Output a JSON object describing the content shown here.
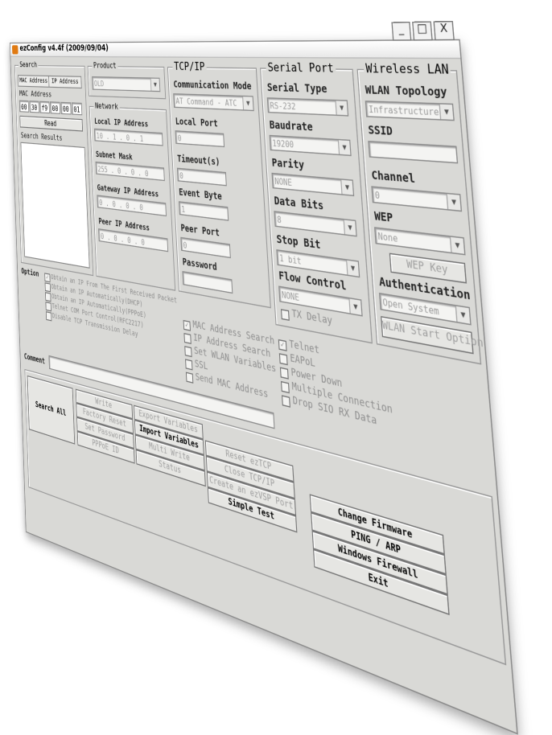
{
  "window": {
    "title": "ezConfig v4.4f (2009/09/04)",
    "controls": [
      "_",
      "□",
      "X"
    ]
  },
  "search": {
    "legend": "Search",
    "tabs": [
      "MAC Address",
      "IP Address"
    ],
    "mac_label": "MAC Address",
    "mac_octets": [
      "00",
      "30",
      "f9",
      "00",
      "00",
      "01"
    ],
    "read_button": "Read",
    "results_label": "Search Results"
  },
  "product": {
    "legend": "Product",
    "value": "OLD"
  },
  "network": {
    "legend": "Network",
    "local_ip_label": "Local IP Address",
    "local_ip": "10 . 1 . 0 . 1",
    "subnet_label": "Subnet Mask",
    "subnet": "255 . 0 . 0 . 0",
    "gateway_label": "Gateway IP Address",
    "gateway": "0 . 0 . 0 . 0",
    "peer_ip_label": "Peer IP Address",
    "peer_ip": "0 . 0 . 0 . 0"
  },
  "tcpip": {
    "legend": "TCP/IP",
    "comm_mode_label": "Communication Mode",
    "comm_mode": "AT Command - ATC",
    "local_port_label": "Local Port",
    "local_port": "0",
    "timeout_label": "Timeout(s)",
    "timeout": "0",
    "event_byte_label": "Event Byte",
    "event_byte": "1",
    "peer_port_label": "Peer Port",
    "peer_port": "0",
    "password_label": "Password",
    "password": ""
  },
  "serial": {
    "legend": "Serial Port",
    "type_label": "Serial Type",
    "type": "RS-232",
    "baud_label": "Baudrate",
    "baud": "19200",
    "parity_label": "Parity",
    "parity": "NONE",
    "databits_label": "Data Bits",
    "databits": "8",
    "stopbit_label": "Stop Bit",
    "stopbit": "1 bit",
    "flow_label": "Flow Control",
    "flow": "NONE",
    "tx_delay": "TX Delay"
  },
  "wlan": {
    "legend": "Wireless LAN",
    "topology_label": "WLAN Topology",
    "topology": "Infrastructure",
    "ssid_label": "SSID",
    "ssid": "",
    "channel_label": "Channel",
    "channel": "0",
    "wep_label": "WEP",
    "wep": "None",
    "wep_key_button": "WEP Key",
    "auth_label": "Authentication",
    "auth": "Open System",
    "start_button": "WLAN Start Option"
  },
  "option": {
    "label": "Option",
    "left": [
      "Obtain an IP From The First Received Packet",
      "Obtain an IP Automatically(DHCP)",
      "Obtain an IP Automatically(PPPoE)",
      "Telnet COM Port Control(RFC2217)",
      "Disable TCP Transmission Delay"
    ],
    "mid": [
      "MAC Address Search",
      "IP Address Search",
      "Set WLAN Variables",
      "SSL",
      "Send MAC Address"
    ],
    "right": [
      "Telnet",
      "EAPoL",
      "Power Down",
      "Multiple Connection",
      "Drop SIO RX Data"
    ]
  },
  "comment": {
    "label": "Comment",
    "value": ""
  },
  "buttons": {
    "search_all": "Search All",
    "write": "Write",
    "factory_reset": "Factory Reset",
    "set_password": "Set Password",
    "pppoe_id": "PPPoE ID",
    "export_vars": "Export Variables",
    "import_vars": "Import Variables",
    "multi_write": "Multi Write",
    "status": "Status",
    "reset_eztcp": "Reset ezTCP",
    "close_tcpip": "Close TCP/IP",
    "create_ezvsp": "Create an ezVSP Port",
    "simple_test": "Simple Test",
    "change_firmware": "Change Firmware",
    "ping_arp": "PING / ARP",
    "windows_firewall": "Windows Firewall",
    "exit": "Exit"
  },
  "colors": {
    "window_bg": "#d9d9d6",
    "title_icon": "#e07a12",
    "disabled_text": "#9e9e9e"
  }
}
